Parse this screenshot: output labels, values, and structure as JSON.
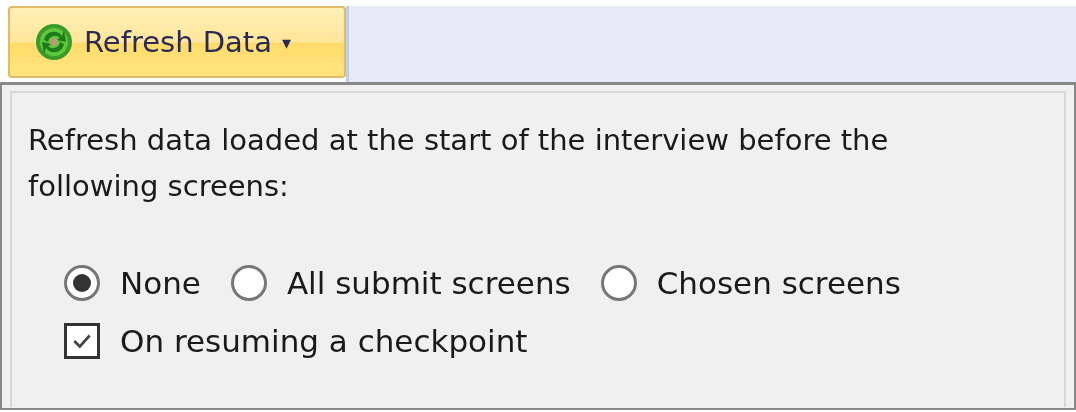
{
  "toolbar": {
    "button": {
      "label": "Refresh Data",
      "caret": "▾",
      "pressed": true
    }
  },
  "panel": {
    "description": "Refresh data loaded at the start of the interview before the following screens:",
    "options": [
      {
        "label": "None",
        "selected": true
      },
      {
        "label": "All submit screens",
        "selected": false
      },
      {
        "label": "Chosen screens",
        "selected": false
      }
    ],
    "checkbox": {
      "label": "On resuming a checkpoint",
      "checked": true
    }
  }
}
